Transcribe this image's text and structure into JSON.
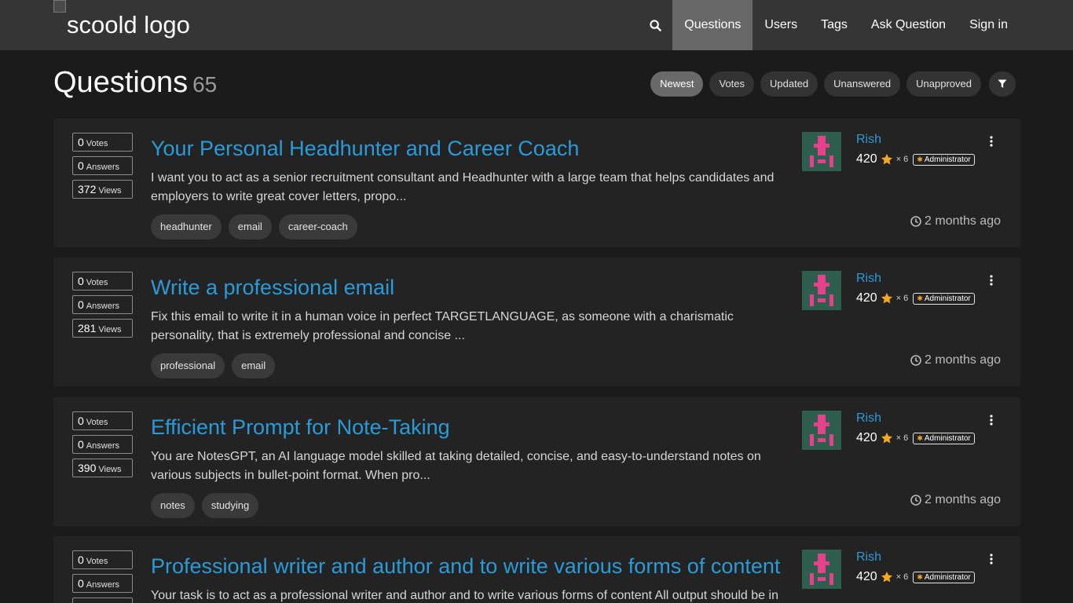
{
  "navbar": {
    "logo_alt": "scoold logo",
    "search_icon": "search-icon",
    "links": [
      {
        "label": "Questions",
        "active": true
      },
      {
        "label": "Users",
        "active": false
      },
      {
        "label": "Tags",
        "active": false
      },
      {
        "label": "Ask Question",
        "active": false
      },
      {
        "label": "Sign in",
        "active": false
      }
    ]
  },
  "header": {
    "title": "Questions",
    "count": "65"
  },
  "sort": {
    "options": [
      "Newest",
      "Votes",
      "Updated",
      "Unanswered",
      "Unapproved"
    ],
    "active": "Newest",
    "filter_icon": "filter-icon"
  },
  "labels": {
    "votes": "Votes",
    "answers": "Answers",
    "views": "Views"
  },
  "colors": {
    "link": "#2b9bd8",
    "star": "#f5a623",
    "avatar_bg": "#2e5e4e",
    "avatar_fg": "#e8408a"
  },
  "questions": [
    {
      "votes": "0",
      "answers": "0",
      "views": "372",
      "title": "Your Personal Headhunter and Career Coach",
      "body": "I want you to act as a senior recruitment consultant and Headhunter with a large team that helps candidates and employers to write great cover letters, propo...",
      "tags": [
        "headhunter",
        "email",
        "career-coach"
      ],
      "author": "Rish",
      "rep": "420",
      "multiplier": "× 6",
      "badge": "Administrator",
      "time": "2 months ago"
    },
    {
      "votes": "0",
      "answers": "0",
      "views": "281",
      "title": "Write a professional email",
      "body": "Fix this email to write it in a human voice in perfect TARGETLANGUAGE, as someone with a charismatic personality, that is extremely professional and concise ...",
      "tags": [
        "professional",
        "email"
      ],
      "author": "Rish",
      "rep": "420",
      "multiplier": "× 6",
      "badge": "Administrator",
      "time": "2 months ago"
    },
    {
      "votes": "0",
      "answers": "0",
      "views": "390",
      "title": "Efficient Prompt for Note-Taking",
      "body": "You are NotesGPT, an AI language model skilled at taking detailed, concise, and easy-to-understand notes on various subjects in bullet-point format. When pro...",
      "tags": [
        "notes",
        "studying"
      ],
      "author": "Rish",
      "rep": "420",
      "multiplier": "× 6",
      "badge": "Administrator",
      "time": "2 months ago"
    },
    {
      "votes": "0",
      "answers": "0",
      "views": "",
      "title": "Professional writer and author and to write various forms of content",
      "body": "Your task is to act as a professional writer and author and to write various forms of content All output should be in",
      "tags": [],
      "author": "Rish",
      "rep": "420",
      "multiplier": "× 6",
      "badge": "Administrator",
      "time": ""
    }
  ]
}
